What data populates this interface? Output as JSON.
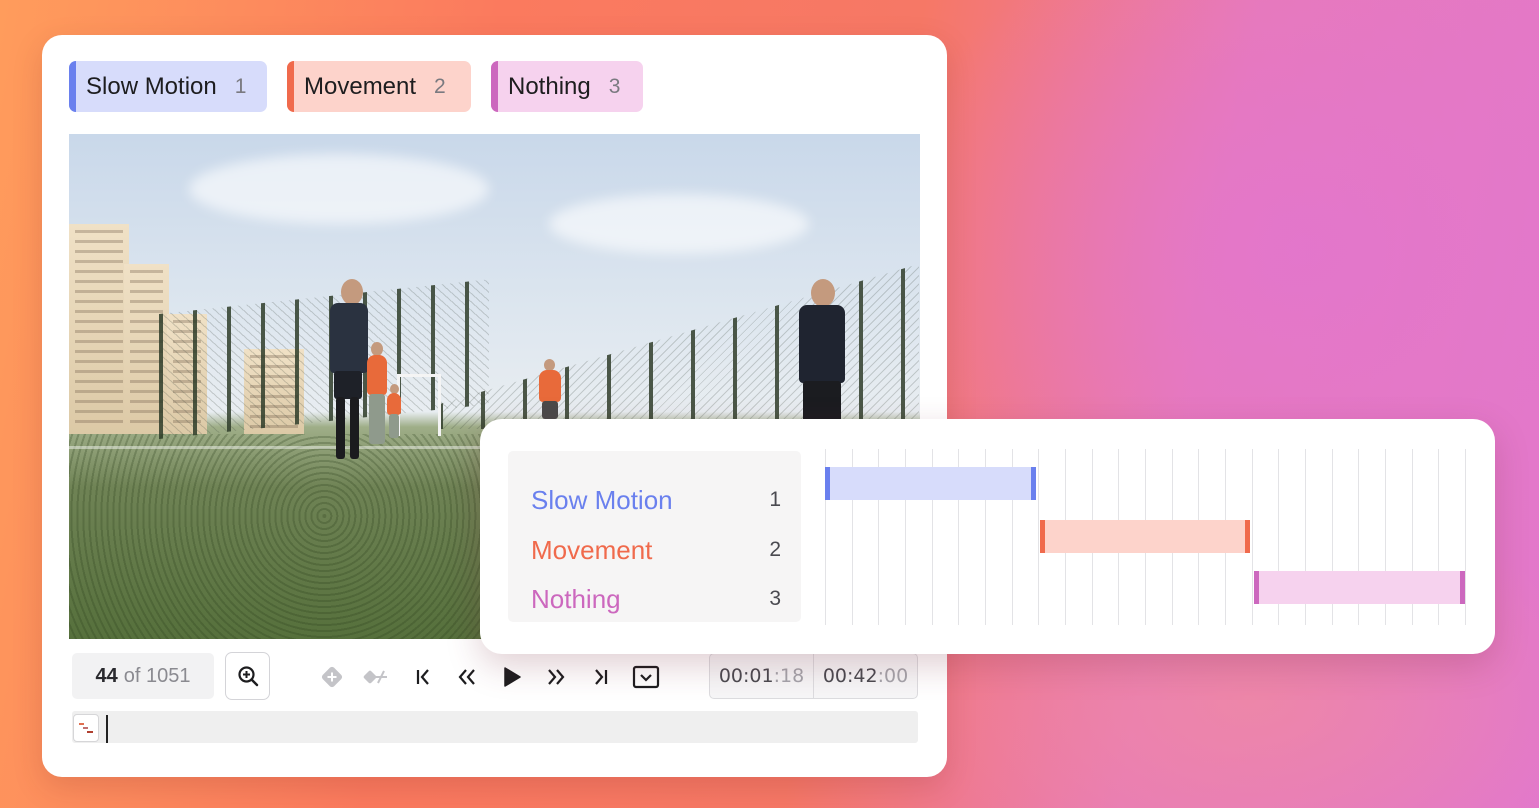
{
  "labels": [
    {
      "name": "Slow Motion",
      "key": "1",
      "color": "#6a80ee",
      "bg": "#d7dcfb"
    },
    {
      "name": "Movement",
      "key": "2",
      "color": "#f06a4c",
      "bg": "#fdd3cb"
    },
    {
      "name": "Nothing",
      "key": "3",
      "color": "#cc68be",
      "bg": "#f6d2ee"
    }
  ],
  "player": {
    "frame_current": "44",
    "frame_of": "of 1051",
    "time_current_main": "00:01",
    "time_current_frac": ":18",
    "time_total_main": "00:42",
    "time_total_frac": ":00"
  },
  "icons": {
    "zoom": "zoom-in-icon",
    "add_keyframe": "add-keyframe-icon",
    "remove_keyframe": "remove-keyframe-icon",
    "go_start": "skip-to-start-icon",
    "step_back": "rewind-icon",
    "play": "play-icon",
    "step_forward": "fast-forward-icon",
    "go_end": "skip-to-end-icon",
    "settings": "player-settings-icon",
    "timeline_toggle": "timeline-segments-icon"
  },
  "timeline": {
    "rows": [
      {
        "name": "Slow Motion",
        "key": "1",
        "color": "#6a80ee",
        "start": 0.0,
        "end": 0.333
      },
      {
        "name": "Movement",
        "key": "2",
        "color": "#f06a4c",
        "start": 0.333,
        "end": 0.667
      },
      {
        "name": "Nothing",
        "key": "3",
        "color": "#cc68be",
        "start": 0.667,
        "end": 1.0
      }
    ]
  }
}
